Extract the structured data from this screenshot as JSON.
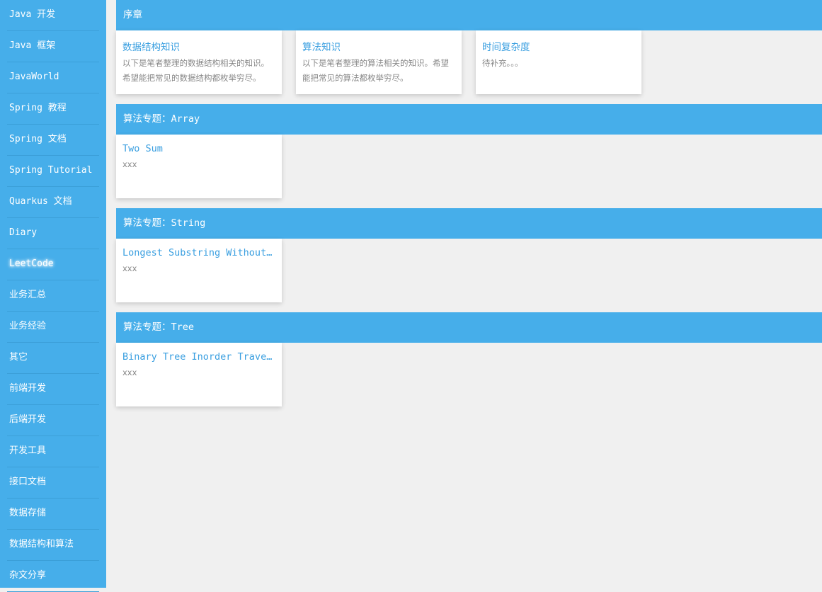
{
  "sidebar": {
    "items": [
      "Java 开发",
      "Java 框架",
      "JavaWorld",
      "Spring 教程",
      "Spring 文档",
      "Spring Tutorial",
      "Quarkus 文档",
      "Diary",
      "LeetCode",
      "业务汇总",
      "业务经验",
      "其它",
      "前端开发",
      "后端开发",
      "开发工具",
      "接口文档",
      "数据存储",
      "数据结构和算法",
      "杂文分享"
    ],
    "active": "LeetCode"
  },
  "sections": [
    {
      "title": "序章",
      "cards": [
        {
          "title": "数据结构知识",
          "desc": "以下是笔者整理的数据结构相关的知识。希望能把常见的数据结构都枚举穷尽。"
        },
        {
          "title": "算法知识",
          "desc": "以下是笔者整理的算法相关的知识。希望能把常见的算法都枚举穷尽。"
        },
        {
          "title": "时间复杂度",
          "desc": "待补充。。。"
        }
      ]
    },
    {
      "title": "算法专题：Array",
      "cards": [
        {
          "title": "Two Sum",
          "desc": "xxx"
        }
      ]
    },
    {
      "title": "算法专题：String",
      "cards": [
        {
          "title": "Longest Substring Without Repeating Characters",
          "desc": "xxx"
        }
      ]
    },
    {
      "title": "算法专题：Tree",
      "cards": [
        {
          "title": "Binary Tree Inorder Traversal",
          "desc": "xxx"
        }
      ]
    }
  ]
}
